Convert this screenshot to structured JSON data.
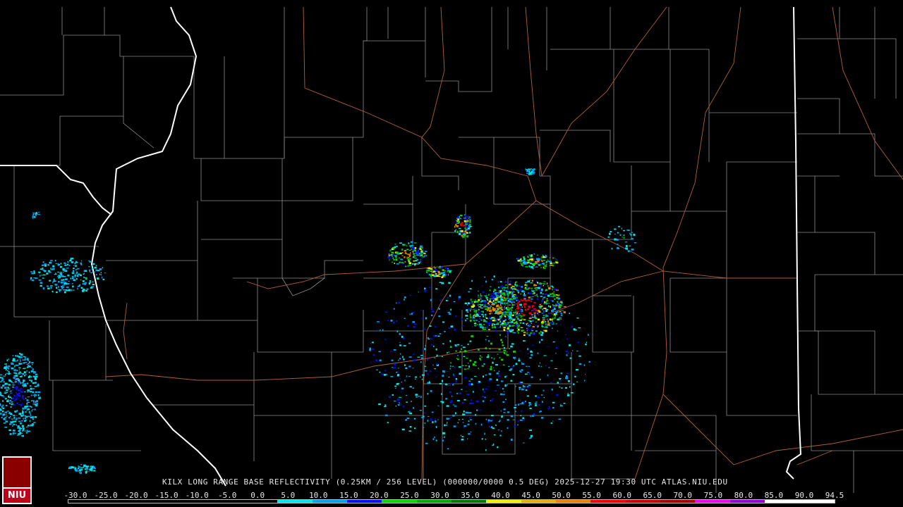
{
  "map": {
    "product_caption": "KILX LONG RANGE BASE REFLECTIVITY (0.25KM / 256 LEVEL) (000000/0000 0.5 DEG) 2025-12-27 19:30 UTC  ATLAS.NIU.EDU",
    "colors": {
      "background": "#000000",
      "county_lines": "#8c8c8c",
      "state_lines": "#ffffff",
      "highways": "#b0603a"
    },
    "radar_site": "KILX"
  },
  "scale": {
    "labels": [
      "-30.0",
      "-25.0",
      "-20.0",
      "-15.0",
      "-10.0",
      "-5.0",
      "0.0",
      "5.0",
      "10.0",
      "15.0",
      "20.0",
      "25.0",
      "30.0",
      "35.0",
      "40.0",
      "45.0",
      "50.0",
      "55.0",
      "60.0",
      "65.0",
      "70.0",
      "75.0",
      "80.0",
      "85.0",
      "90.0",
      "94.5"
    ],
    "colors": [
      "#000000",
      "#000000",
      "#000000",
      "#000000",
      "#000000",
      "#000000",
      "#00e8e8",
      "#00a0f0",
      "#0010f0",
      "#00d800",
      "#00a800",
      "#007800",
      "#f0f000",
      "#e8b000",
      "#f08000",
      "#f00000",
      "#c80000",
      "#a80000",
      "#f000f0",
      "#9000d8",
      "#ffffff",
      "#ffffff"
    ]
  },
  "logo": {
    "text": "NIU"
  }
}
